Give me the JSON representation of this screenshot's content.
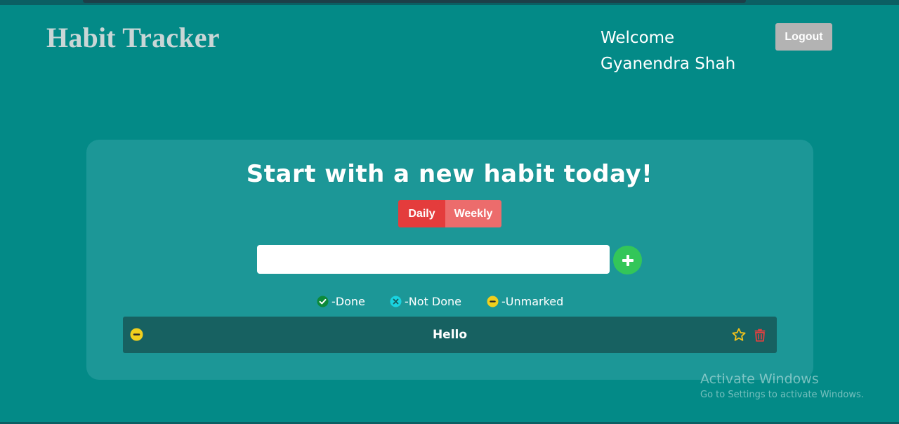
{
  "app": {
    "title": "Habit Tracker"
  },
  "header": {
    "welcome_line1": "Welcome",
    "welcome_line2": "Gyanendra Shah",
    "logout_label": "Logout"
  },
  "main": {
    "headline": "Start with a new habit today!",
    "frequency_tabs": [
      {
        "label": "Daily",
        "selected": true
      },
      {
        "label": "Weekly",
        "selected": false
      }
    ],
    "habit_input": {
      "value": "",
      "placeholder": ""
    },
    "add_icon": "plus-icon"
  },
  "legend": [
    {
      "icon": "check-circle-icon",
      "label": "-Done",
      "color": "#0c8a3a"
    },
    {
      "icon": "x-circle-icon",
      "label": "-Not Done",
      "color": "#19d3e0"
    },
    {
      "icon": "minus-circle-icon",
      "label": "-Unmarked",
      "color": "#f0cf1e"
    }
  ],
  "habits": [
    {
      "name": "Hello",
      "status": "unmarked",
      "status_icon": "minus-circle-icon",
      "favorite_icon": "star-outline-icon",
      "delete_icon": "trash-icon"
    }
  ],
  "colors": {
    "background": "#038a87",
    "card": "#1c9797",
    "row": "#176161",
    "daily": "#e43c3c",
    "weekly": "#ec6c6c",
    "add_button": "#33c659",
    "logout_button": "#b3b3b3",
    "star": "#f2c21b",
    "trash": "#e04040"
  },
  "os_watermark": {
    "title": "Activate Windows",
    "subtitle": "Go to Settings to activate Windows."
  }
}
